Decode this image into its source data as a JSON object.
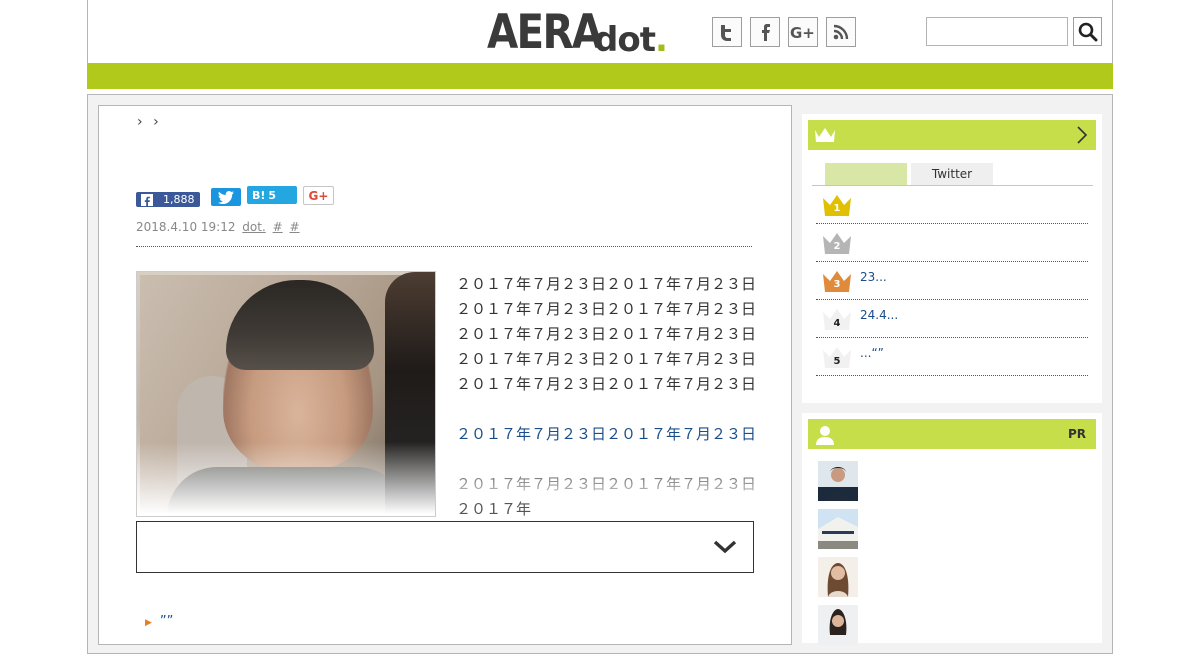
{
  "header": {
    "logo_main": "AERA",
    "logo_sub": "dot",
    "logo_point": ".",
    "social_icons": [
      "twitter-icon",
      "facebook-icon",
      "google-plus-icon",
      "rss-icon"
    ],
    "search_placeholder": "",
    "search_icon": "search-icon",
    "colors": {
      "accent": "#b0c91a",
      "logo": "#3a3a3a"
    }
  },
  "breadcrumb": {
    "sep1": "›",
    "sep2": "›"
  },
  "share": {
    "facebook_count": "1,888",
    "hatena_label": "B!",
    "hatena_count": "5",
    "gplus_label": "G+"
  },
  "article": {
    "date": "2018.4.10 19:12",
    "source": "dot.",
    "tag1": "#",
    "tag2": "#",
    "body1": "２０１７年７月２３日２０１７年７月２３日２０１７年７月２３日２０１７年７月２３日２０１７年７月２３日２０１７年７月２３日２０１７年７月２３日２０１７年７月２３日",
    "body1_lines": [
      "２０１７年７月２３日２０１７年７月２３日",
      "２０１７年７月２３日２０１７年７月２３日",
      "２０１７年７月２３日２０１７年７月２３日",
      "２０１７年７月２３日２０１７年７月２３日",
      "２０１７年７月２３日２０１７年７月２３日"
    ],
    "link": "２０１７年７月２３日２０１７年７月２３日",
    "body2": "２０１７年７月２３日２０１７年７月２３日２０１７年",
    "bottom_link": "””"
  },
  "ranking": {
    "tab_active": "",
    "tab_twitter": "Twitter",
    "rows": [
      {
        "rank": "1",
        "text": ""
      },
      {
        "rank": "2",
        "text": ""
      },
      {
        "rank": "3",
        "text": "23..."
      },
      {
        "rank": "4",
        "text": "24.4..."
      },
      {
        "rank": "5",
        "text": "...“”"
      }
    ]
  },
  "pr": {
    "label": "PR"
  }
}
